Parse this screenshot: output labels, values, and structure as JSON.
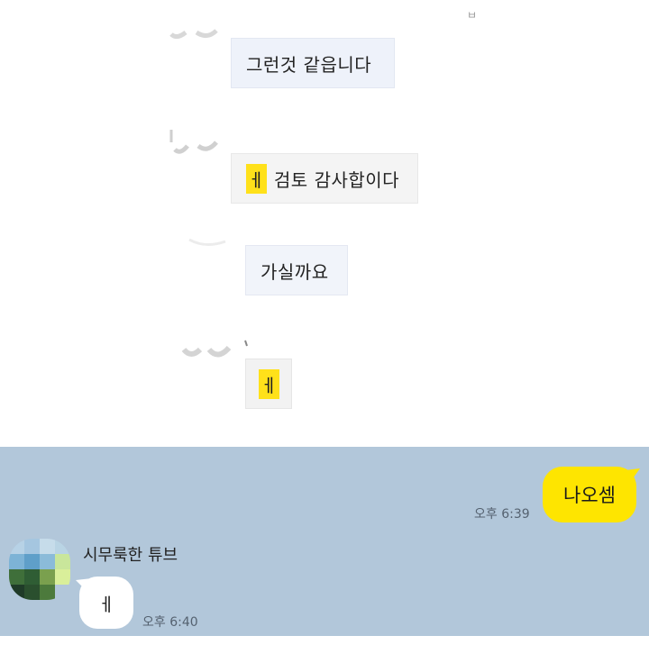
{
  "screenshot": {
    "messages": [
      {
        "text": "그런것 같읍니다",
        "highlight": ""
      },
      {
        "text": "검토 감사합이다",
        "highlight": "ㅔ"
      },
      {
        "text": "가실까요",
        "highlight": ""
      },
      {
        "text": "",
        "highlight": "ㅔ"
      }
    ],
    "corner_mark": "ㅂ",
    "highlight_color": "#ffe11a"
  },
  "chat": {
    "background": "#b2c7da",
    "outgoing": {
      "text": "나오셈",
      "time": "오후 6:39",
      "bubble_color": "#fee500"
    },
    "incoming": {
      "sender": "시무룩한 튜브",
      "text": "ㅔ",
      "time": "오후 6:40",
      "bubble_color": "#ffffff"
    },
    "avatar_colors": [
      "#b7d2e6",
      "#a5c6e0",
      "#c6dcea",
      "#b9d4e4",
      "#7db3d6",
      "#5f9fc9",
      "#8bbbd9",
      "#c9e69b",
      "#3f6f3a",
      "#2f5d34",
      "#7aa04e",
      "#d9ef9a",
      "#1f3b28",
      "#2a4f2e",
      "#4c7a3c",
      "#b2c7da"
    ]
  }
}
